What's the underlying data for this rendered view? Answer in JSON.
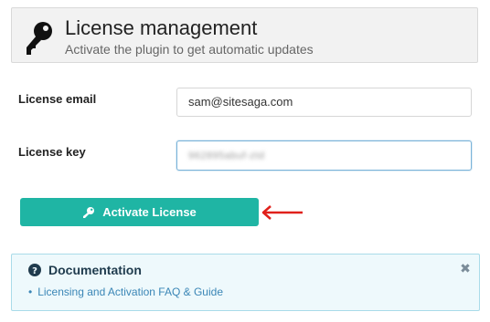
{
  "header": {
    "title": "License management",
    "subtitle": "Activate the plugin to get automatic updates",
    "icon": "key-icon"
  },
  "form": {
    "email_label": "License email",
    "email_value": "sam@sitesaga.com",
    "key_label": "License key",
    "key_value": "962895abuf-ztd"
  },
  "actions": {
    "activate_label": "Activate License",
    "button_color": "#1fb5a4",
    "annotation_color": "#e0201b"
  },
  "documentation": {
    "title": "Documentation",
    "links": [
      "Licensing and Activation FAQ & Guide"
    ],
    "close_icon": "close-icon",
    "help_icon": "question-circle-icon"
  }
}
